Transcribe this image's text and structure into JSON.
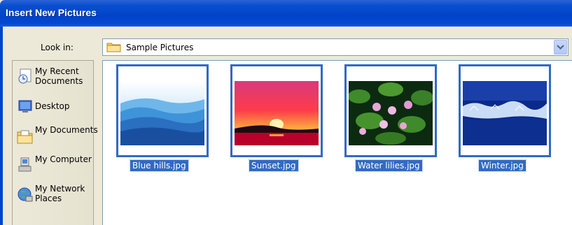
{
  "dialog": {
    "title": "Insert New Pictures"
  },
  "lookin": {
    "label": "Look in:",
    "value": "Sample Pictures",
    "icon": "folder-icon"
  },
  "places": [
    {
      "label": "My Recent Documents",
      "icon": "recent-documents-icon"
    },
    {
      "label": "Desktop",
      "icon": "desktop-icon"
    },
    {
      "label": "My Documents",
      "icon": "my-documents-icon"
    },
    {
      "label": "My Computer",
      "icon": "my-computer-icon"
    },
    {
      "label": "My Network Places",
      "icon": "network-places-icon"
    }
  ],
  "files": [
    {
      "name": "Blue hills.jpg",
      "selected": true
    },
    {
      "name": "Sunset.jpg",
      "selected": true
    },
    {
      "name": "Water lilies.jpg",
      "selected": true
    },
    {
      "name": "Winter.jpg",
      "selected": true
    }
  ],
  "colors": {
    "titlebar": "#0043c8",
    "selection": "#316ac5"
  }
}
